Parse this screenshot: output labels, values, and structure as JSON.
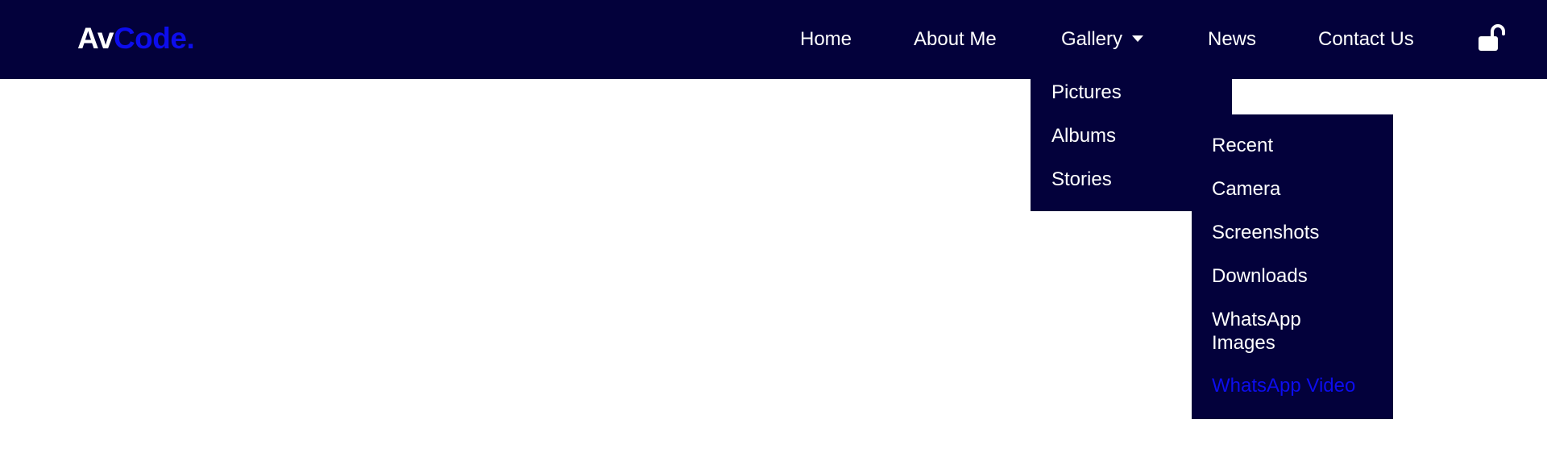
{
  "logo": {
    "part1": "Av",
    "part2": "Code."
  },
  "nav": {
    "home": "Home",
    "about": "About Me",
    "gallery": "Gallery",
    "news": "News",
    "contact": "Contact Us",
    "lock_icon": "unlock-icon"
  },
  "gallery_menu": {
    "items": [
      "Pictures",
      "Albums",
      "Stories"
    ]
  },
  "albums_menu": {
    "items": [
      "Recent",
      "Camera",
      "Screenshots",
      "Downloads",
      "WhatsApp Images",
      "WhatsApp Video"
    ],
    "active_item": "WhatsApp Video"
  },
  "colors": {
    "navbar_bg": "#03013b",
    "accent": "#0d0ded",
    "text": "#ffffff"
  }
}
